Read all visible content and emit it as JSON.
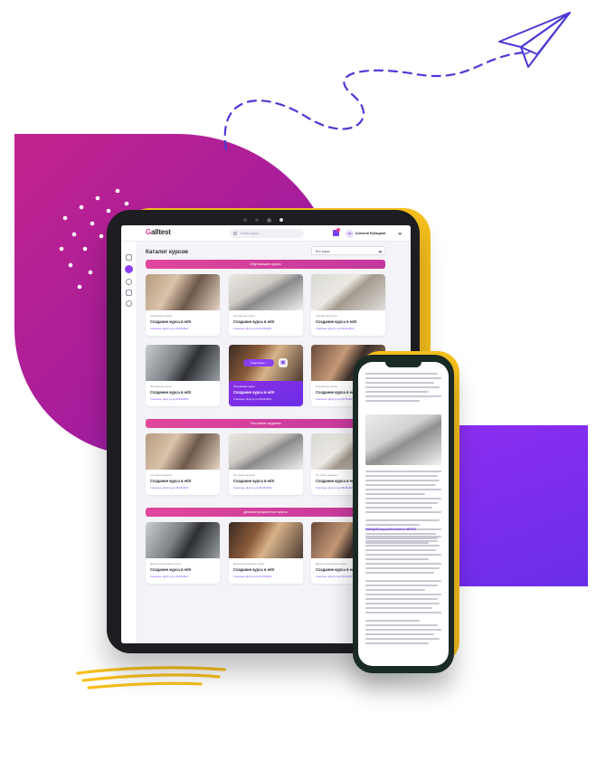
{
  "app": {
    "logo_prefix": "G",
    "logo_name": "alltest",
    "search_placeholder": "Искать курсы...",
    "user_initials": "АК",
    "user_name": "Алексей Рубацкий"
  },
  "catalog": {
    "title": "Каталог курсов",
    "filter_value": "Все курсы",
    "sections": [
      {
        "label": "Обучающие курсы",
        "cards": [
          {
            "category": "Обучающие курсы",
            "title": "Создание курса в edX",
            "meta": "3 месяца • Доступ до 06.06.2021",
            "image": "woman-at-laptop"
          },
          {
            "category": "Обучающие курсы",
            "title": "Создание курса в edX",
            "meta": "3 месяца • Доступ до 06.06.2021",
            "image": "laptop-on-desk"
          },
          {
            "category": "Обучающие курсы",
            "title": "Создание курса в edX",
            "meta": "3 месяца • Доступ до 06.06.2021",
            "image": "hand-with-tablet"
          },
          {
            "category": "Обучающие курсы",
            "title": "Создание курса в edX",
            "meta": "3 месяца • Доступ до 06.06.2021",
            "image": "typing-hands"
          },
          {
            "category": "Обучающие курсы",
            "title": "Создание курса в edX",
            "meta": "3 месяца • Доступ до 06.06.2021",
            "image": "cafe-laptop",
            "active": true,
            "more_label": "Подробнее  >"
          },
          {
            "category": "Обучающие курсы",
            "title": "Создание курса в edX",
            "meta": "3 месяца • Доступ до 06.06.2021",
            "image": "woman-meeting"
          }
        ]
      },
      {
        "label": "Тестовые задания",
        "cards": [
          {
            "category": "Тестовые задания",
            "title": "Создание курса в edX",
            "meta": "3 месяца • Доступ до 06.06.2021",
            "image": "woman-at-laptop"
          },
          {
            "category": "Тестовые задания",
            "title": "Создание курса в edX",
            "meta": "3 месяца • Доступ до 06.06.2021",
            "image": "laptop-on-desk"
          },
          {
            "category": "Тестовые задания",
            "title": "Создание курса в edX",
            "meta": "3 месяца • Доступ до 06.06.2021",
            "image": "hand-with-tablet"
          }
        ]
      },
      {
        "label": "Демонстрационные курсы",
        "cards": [
          {
            "category": "Демонстрационные курсы",
            "title": "Создание курса в edX",
            "meta": "3 месяца • Доступ до 06.06.2021",
            "image": "typing-hands"
          },
          {
            "category": "Демонстрационные курсы",
            "title": "Создание курса в edX",
            "meta": "3 месяца • Доступ до 06.06.2021",
            "image": "cafe-laptop"
          },
          {
            "category": "Демонстрационные курсы",
            "title": "Создание курса в edX",
            "meta": "3 месяца • Доступ до 06.06.2021",
            "image": "woman-meeting"
          }
        ]
      }
    ]
  },
  "phone": {
    "heading": "Набор/Бонусы/Контакты MOOC"
  },
  "colors": {
    "accent": "#7b3ff2",
    "section_bar": "#d9409c",
    "magenta_blob": "#b5208f",
    "violet_blob": "#7a2deb",
    "device_yellow": "#f7c01e"
  }
}
